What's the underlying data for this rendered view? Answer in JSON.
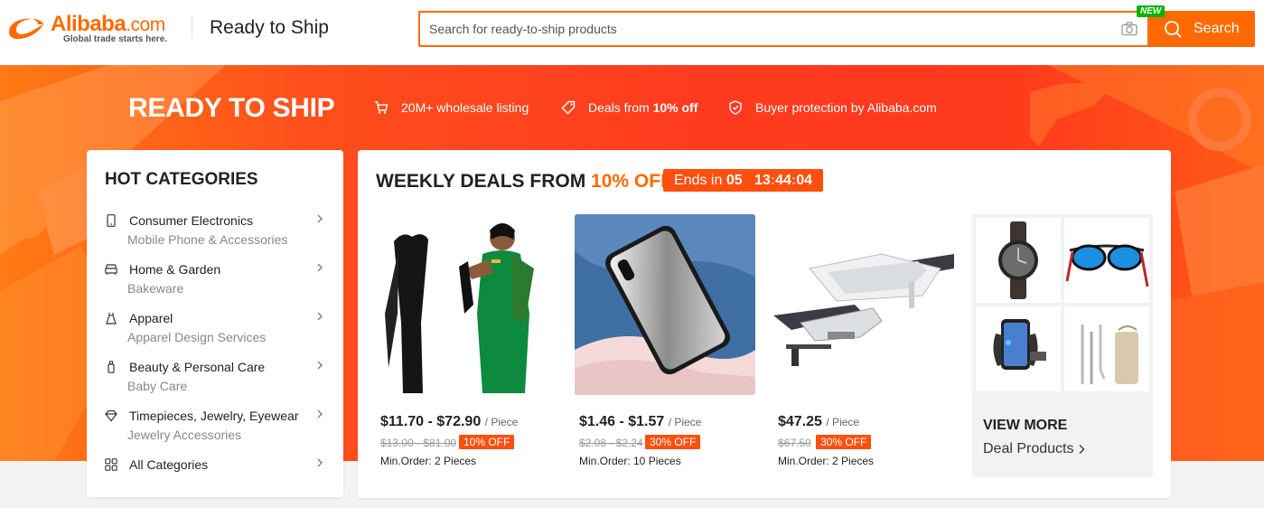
{
  "header": {
    "logo_text": "Alibaba",
    "logo_dotcom": ".com",
    "logo_tagline": "Global trade starts here.",
    "title": "Ready to Ship",
    "search": {
      "placeholder": "Search for ready-to-ship products",
      "value": "",
      "new_badge": "NEW",
      "button_label": "Search"
    }
  },
  "banner": {
    "title": "READY TO SHIP",
    "features": [
      {
        "icon": "cart-icon",
        "text": "20M+ wholesale listing",
        "bold": ""
      },
      {
        "icon": "tag-icon",
        "text": "Deals from ",
        "bold": "10% off"
      },
      {
        "icon": "shield-icon",
        "text": "Buyer protection by Alibaba.com",
        "bold": ""
      }
    ]
  },
  "categories": {
    "heading": "HOT CATEGORIES",
    "items": [
      {
        "icon": "phone-icon",
        "label": "Consumer Electronics",
        "sub": "Mobile Phone & Accessories"
      },
      {
        "icon": "sofa-icon",
        "label": "Home & Garden",
        "sub": "Bakeware"
      },
      {
        "icon": "dress-icon",
        "label": "Apparel",
        "sub": "Apparel Design Services"
      },
      {
        "icon": "bottle-icon",
        "label": "Beauty & Personal Care",
        "sub": "Baby Care"
      },
      {
        "icon": "diamond-icon",
        "label": "Timepieces, Jewelry, Eyewear",
        "sub": "Jewelry Accessories"
      },
      {
        "icon": "grid-icon",
        "label": "All Categories",
        "sub": ""
      }
    ]
  },
  "deals": {
    "title": "WEEKLY DEALS FROM",
    "title_pct": "10% OFF",
    "ends_label": "Ends in",
    "countdown": {
      "days": "05",
      "hours": "13",
      "minutes": "44",
      "seconds": "04",
      "sep": ":"
    },
    "products": [
      {
        "price": "$11.70 - $72.90",
        "unit": "/ Piece",
        "orig": "$13.00 - $81.00",
        "discount": "10% OFF",
        "moq": "Min.Order: 2 Pieces",
        "image": "hair-extensions-image"
      },
      {
        "price": "$1.46 - $1.57",
        "unit": "/ Piece",
        "orig": "$2.08 - $2.24",
        "discount": "30% OFF",
        "moq": "Min.Order: 10 Pieces",
        "image": "mirror-phone-case-image"
      },
      {
        "price": "$47.25",
        "unit": "/ Piece",
        "orig": "$67.50",
        "discount": "30% OFF",
        "moq": "Min.Order: 2 Pieces",
        "image": "solar-street-light-image"
      }
    ],
    "view_more": {
      "label": "VIEW MORE",
      "link": "Deal Products",
      "thumbs": [
        "wooden-watch-image",
        "sunglasses-image",
        "phone-car-mount-image",
        "metal-straws-image"
      ]
    }
  },
  "colors": {
    "brand": "#ff6a00",
    "discount": "#ff4f0f",
    "new_badge": "#00b400",
    "banner": "#ff3b1f"
  }
}
